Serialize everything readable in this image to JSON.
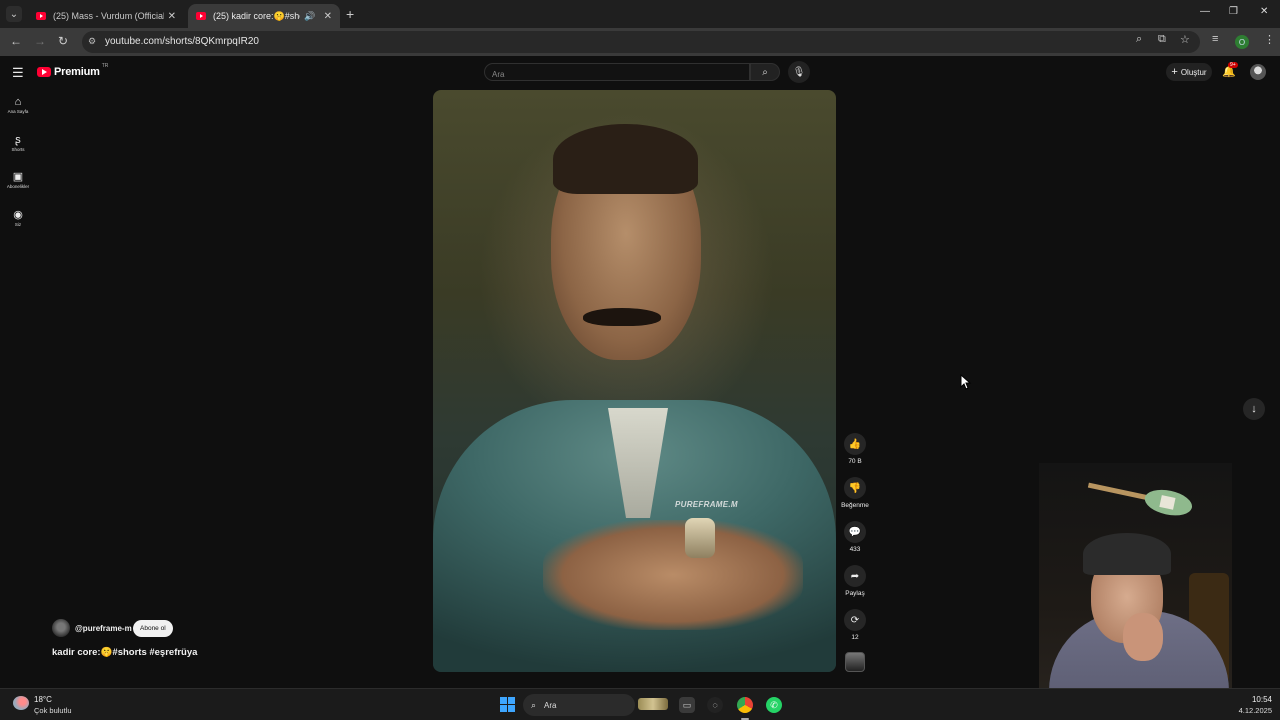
{
  "browser": {
    "tabs": [
      {
        "label": "(25) Mass - Vurdum (Official Vi",
        "active": false
      },
      {
        "label": "(25) kadir core:🤫#shorts #",
        "active": true
      }
    ],
    "url": "youtube.com/shorts/8QKmrpqIR20",
    "profile_initial": "O"
  },
  "youtube": {
    "brand": "Premium",
    "country": "TR",
    "search_placeholder": "Ara",
    "create_label": "Oluştur",
    "notification_count": "9+",
    "sidebar": [
      {
        "label": "Ana Sayfa",
        "icon": "home-icon",
        "glyph": "⌂"
      },
      {
        "label": "Shorts",
        "icon": "shorts-icon",
        "glyph": "ʂ"
      },
      {
        "label": "Abonelikler",
        "icon": "subscriptions-icon",
        "glyph": "▣"
      },
      {
        "label": "Siz",
        "icon": "you-icon",
        "glyph": "◉"
      }
    ]
  },
  "short": {
    "watermark": "PUREFRAME.M",
    "channel": "@pureframe-m",
    "subscribe_label": "Abone ol",
    "title": "kadir core:🤫#shorts #eşrefrüya",
    "actions": {
      "like": "70 B",
      "dislike": "Beğenme",
      "comments": "433",
      "share": "Paylaş",
      "remix": "12"
    }
  },
  "taskbar": {
    "temperature": "18°C",
    "weather": "Çok bulutlu",
    "search": "Ara",
    "time": "10:54",
    "date": "4.12.2025"
  },
  "colors": {
    "youtube_red": "#ff0033",
    "background": "#0f0f0f",
    "windows_blue": "#3ea6ff"
  }
}
